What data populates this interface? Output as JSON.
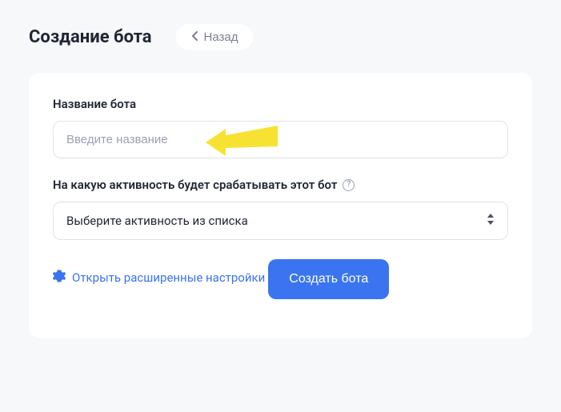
{
  "header": {
    "title": "Создание бота",
    "back_label": "Назад"
  },
  "form": {
    "name_label": "Название бота",
    "name_placeholder": "Введите название",
    "activity_label": "На какую активность будет срабатывать этот бот",
    "activity_placeholder": "Выберите активность из списка",
    "advanced_label": "Открыть расширенные настройки",
    "submit_label": "Создать бота"
  }
}
